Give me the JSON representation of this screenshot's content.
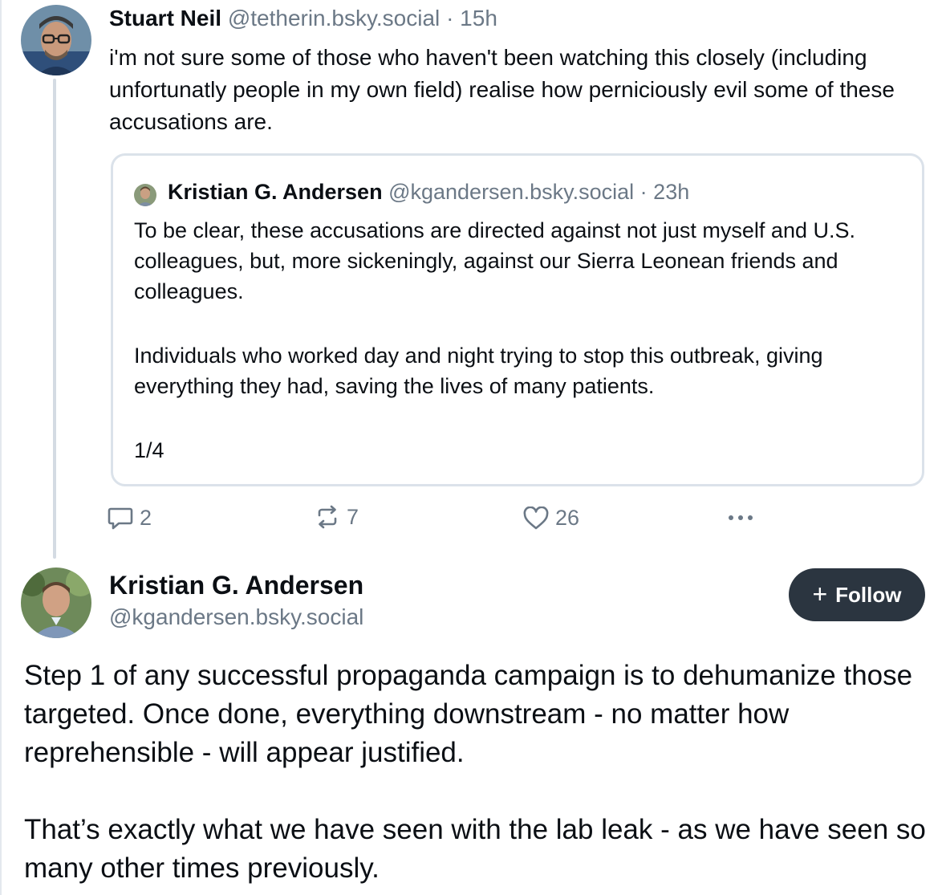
{
  "reply_post": {
    "author_name": "Stuart Neil",
    "handle": "@tetherin.bsky.social",
    "separator": "·",
    "time": "15h",
    "text": "i'm not sure some of those who haven't been watching this closely (including unfortunatly people in my own field) realise how perniciously evil some of these accusations are.",
    "avatar_icon": "user-avatar-icon"
  },
  "quoted_post": {
    "author_name": "Kristian G. Andersen",
    "handle": "@kgandersen.bsky.social",
    "separator": "·",
    "time": "23h",
    "paragraph_1": "To be clear, these accusations are directed against not just myself and U.S. colleagues, but, more sickeningly, against our Sierra Leonean friends and colleagues.",
    "paragraph_2": "Individuals who worked day and night trying to stop this outbreak, giving everything they had, saving the lives of many patients.",
    "paragraph_3": "1/4"
  },
  "actions": {
    "reply_count": "2",
    "repost_count": "7",
    "like_count": "26",
    "reply_icon": "comment-icon",
    "repost_icon": "repost-icon",
    "like_icon": "heart-icon",
    "more_icon": "more-dots-icon"
  },
  "main_post": {
    "author_name": "Kristian G. Andersen",
    "handle": "@kgandersen.bsky.social",
    "follow_icon": "plus-icon",
    "follow_plus": "+",
    "follow_label": "Follow",
    "paragraph_1": "Step 1 of any successful propaganda campaign is to dehumanize those targeted. Once done, everything downstream - no matter how reprehensible - will appear justified.",
    "paragraph_2": "That’s exactly what we have seen with the lab leak - as we have seen so many other times previously."
  },
  "colors": {
    "text": "#0b0f14",
    "muted": "#6b7886",
    "border": "#dbe2ea",
    "thread_line": "#d4dbe3",
    "follow_bg": "#2b3540",
    "follow_text": "#ffffff"
  }
}
